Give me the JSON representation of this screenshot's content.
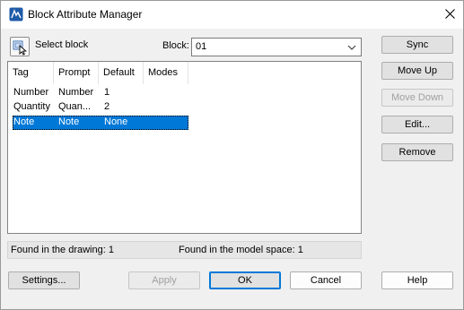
{
  "window": {
    "title": "Block Attribute Manager",
    "icon": "autocad-app-icon",
    "close_icon": "close-icon"
  },
  "select_block": {
    "label": "Select block",
    "icon": "pick-object-icon"
  },
  "block": {
    "label": "Block:",
    "value": "01"
  },
  "table": {
    "columns": [
      "Tag",
      "Prompt",
      "Default",
      "Modes"
    ],
    "rows": [
      {
        "tag": "Number",
        "prompt": "Number",
        "default": "1",
        "modes": ""
      },
      {
        "tag": "Quantity",
        "prompt": "Quan...",
        "default": "2",
        "modes": ""
      },
      {
        "tag": "Note",
        "prompt": "Note",
        "default": "None",
        "modes": "",
        "selected": true
      }
    ]
  },
  "status": {
    "found_drawing": "Found in the drawing: 1",
    "found_model": "Found in the model space: 1"
  },
  "side_buttons": {
    "sync": "Sync",
    "move_up": "Move Up",
    "move_down": "Move Down",
    "edit": "Edit...",
    "remove": "Remove"
  },
  "bottom_buttons": {
    "settings": "Settings...",
    "apply": "Apply",
    "ok": "OK",
    "cancel": "Cancel",
    "help": "Help"
  },
  "colors": {
    "selection": "#0078d7",
    "dialog_bg": "#f0f0f0",
    "accent": "#0078d7"
  }
}
